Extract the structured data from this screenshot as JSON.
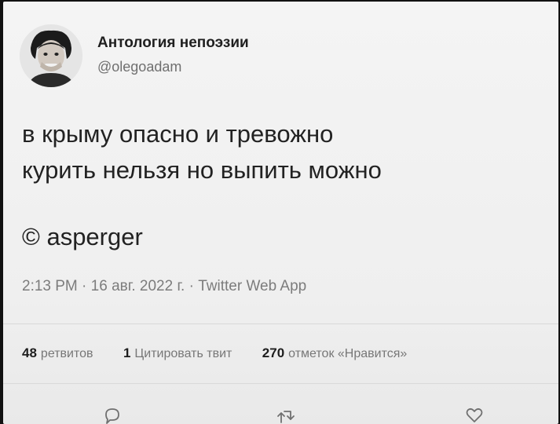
{
  "author": {
    "display_name": "Антология непоэзии",
    "handle": "@olegoadam"
  },
  "tweet": {
    "lines": [
      "в крыму опасно и тревожно",
      "курить нельзя но выпить можно"
    ],
    "credit": "© asperger"
  },
  "meta": {
    "time": "2:13 PM",
    "date": "16 авг. 2022 г.",
    "separator": "·",
    "app": "Twitter Web App"
  },
  "stats": {
    "retweets_count": "48",
    "retweets_label": "ретвитов",
    "quotes_count": "1",
    "quotes_label": "Цитировать твит",
    "likes_count": "270",
    "likes_label": "отметок «Нравится»"
  },
  "actions": {
    "reply_icon": "reply-icon",
    "retweet_icon": "retweet-icon",
    "like_icon": "heart-icon"
  },
  "colors": {
    "background": "#f4f4f4",
    "text": "#222222",
    "muted": "#7c7c7c"
  }
}
